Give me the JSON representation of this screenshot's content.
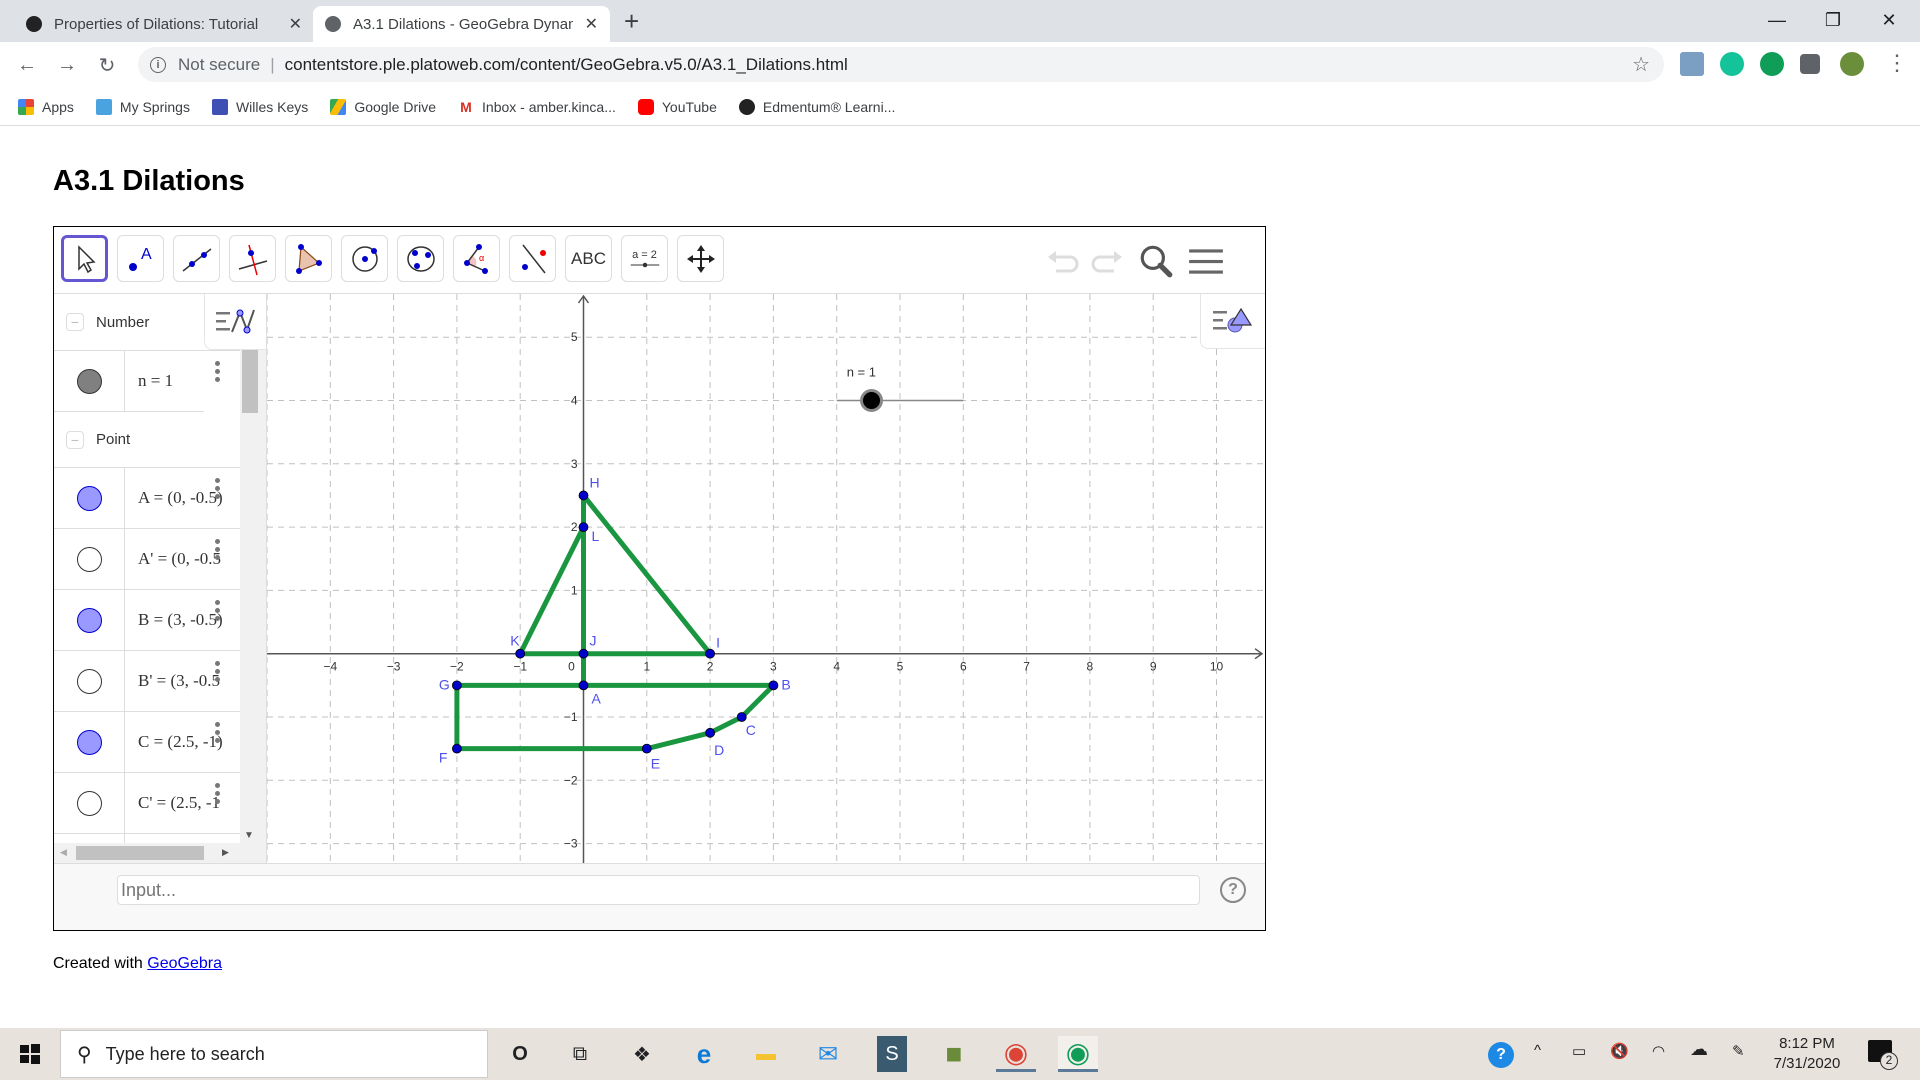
{
  "browser": {
    "tabs": [
      {
        "title": "Properties of Dilations: Tutorial",
        "icon": "edmentum-icon",
        "active": false
      },
      {
        "title": "A3.1 Dilations - GeoGebra Dynam",
        "icon": "globe-icon",
        "active": true
      }
    ],
    "new_tab": "+",
    "close_glyph": "✕",
    "window_controls": {
      "minimize": "—",
      "maximize": "❐",
      "close": "✕"
    },
    "nav": {
      "back": "←",
      "forward": "→",
      "reload": "↻"
    },
    "security_label": "Not secure",
    "url": "contentstore.ple.platoweb.com/content/GeoGebra.v5.0/A3.1_Dilations.html",
    "star": "☆",
    "menu": "⋮",
    "extensions": [
      {
        "name": "anime-extension-icon",
        "color": "#7a9fc2"
      },
      {
        "name": "grammarly-icon",
        "color": "#15c39a"
      },
      {
        "name": "chat-extension-icon",
        "color": "#0f9d58"
      },
      {
        "name": "extensions-puzzle-icon",
        "color": "#5f6368"
      },
      {
        "name": "profile-avatar",
        "color": "#6b8e3a"
      }
    ],
    "bookmarks": [
      {
        "label": "Apps",
        "icon": "apps-grid-icon",
        "color": "#ea4335"
      },
      {
        "label": "My Springs",
        "icon": "graduation-cap-icon",
        "color": "#4aa3df"
      },
      {
        "label": "Willes Keys",
        "icon": "forms-icon",
        "color": "#3f51b5"
      },
      {
        "label": "Google Drive",
        "icon": "google-drive-icon",
        "color": "#fbbc04"
      },
      {
        "label": "Inbox - amber.kinca...",
        "icon": "gmail-icon",
        "color": "#d93025"
      },
      {
        "label": "YouTube",
        "icon": "youtube-icon",
        "color": "#ff0000"
      },
      {
        "label": "Edmentum® Learni...",
        "icon": "edmentum-icon",
        "color": "#222222"
      }
    ]
  },
  "page": {
    "title": "A3.1 Dilations",
    "credit_prefix": "Created with ",
    "credit_link": "GeoGebra"
  },
  "geogebra": {
    "tools": [
      {
        "name": "move-tool",
        "selected": true
      },
      {
        "name": "point-tool"
      },
      {
        "name": "line-tool"
      },
      {
        "name": "perpendicular-line-tool"
      },
      {
        "name": "polygon-tool"
      },
      {
        "name": "circle-center-point-tool"
      },
      {
        "name": "circle-three-points-tool"
      },
      {
        "name": "angle-tool"
      },
      {
        "name": "reflect-line-tool"
      },
      {
        "name": "text-tool",
        "label": "ABC"
      },
      {
        "name": "slider-tool",
        "label": "a = 2"
      },
      {
        "name": "move-graphics-tool"
      }
    ],
    "algebra": {
      "groups": [
        {
          "label": "Number",
          "items": [
            {
              "text": "n = 1",
              "marker": "filled-gray"
            }
          ]
        },
        {
          "label": "Point",
          "items": [
            {
              "text": "A = (0, -0.5)",
              "marker": "filled-blue"
            },
            {
              "text": "A' = (0, -0.5",
              "marker": "hollow"
            },
            {
              "text": "B = (3, -0.5)",
              "marker": "filled-blue"
            },
            {
              "text": "B' = (3, -0.5",
              "marker": "hollow"
            },
            {
              "text": "C = (2.5, -1)",
              "marker": "filled-blue"
            },
            {
              "text": "C' = (2.5, -1",
              "marker": "hollow"
            }
          ]
        }
      ]
    },
    "input_placeholder": "Input...",
    "help": "?",
    "colors": {
      "segment": "#1a9641",
      "point": "#0000cc",
      "label": "#5050ee",
      "grid": "#c0c0c0",
      "axis": "#555555",
      "tool_selected": "#6557d2"
    },
    "graph": {
      "x_ticks": [
        -4,
        -3,
        -2,
        -1,
        0,
        1,
        2,
        3,
        4,
        5,
        6,
        7,
        8,
        9,
        10
      ],
      "y_ticks": [
        -3,
        -2,
        -1,
        1,
        2,
        3,
        4,
        5
      ],
      "points": [
        {
          "label": "A",
          "x": 0,
          "y": -0.5
        },
        {
          "label": "B",
          "x": 3,
          "y": -0.5
        },
        {
          "label": "C",
          "x": 2.5,
          "y": -1
        },
        {
          "label": "D",
          "x": 2,
          "y": -1.25
        },
        {
          "label": "E",
          "x": 1,
          "y": -1.5
        },
        {
          "label": "F",
          "x": -2,
          "y": -1.5
        },
        {
          "label": "G",
          "x": -2,
          "y": -0.5
        },
        {
          "label": "H",
          "x": 0,
          "y": 2.5
        },
        {
          "label": "I",
          "x": 2,
          "y": 0
        },
        {
          "label": "J",
          "x": 0,
          "y": 0
        },
        {
          "label": "K",
          "x": -1,
          "y": 0
        },
        {
          "label": "L",
          "x": 0,
          "y": 2
        }
      ],
      "segments": [
        [
          "G",
          "B"
        ],
        [
          "B",
          "C"
        ],
        [
          "C",
          "D"
        ],
        [
          "D",
          "E"
        ],
        [
          "E",
          "F"
        ],
        [
          "F",
          "G"
        ],
        [
          "K",
          "I"
        ],
        [
          "I",
          "H"
        ],
        [
          "H",
          "A"
        ],
        [
          "K",
          "L"
        ]
      ],
      "slider": {
        "label": "n = 1",
        "x_start": 4,
        "x_end": 6,
        "y": 4,
        "value": 1,
        "handle_x": 4.55
      }
    }
  },
  "taskbar": {
    "search_placeholder": "Type here to search",
    "apps": [
      {
        "name": "cortana-icon",
        "glyph": "O"
      },
      {
        "name": "task-view-icon",
        "glyph": "⧉"
      },
      {
        "name": "dropbox-icon",
        "glyph": "❖"
      },
      {
        "name": "edge-icon",
        "glyph": "e"
      },
      {
        "name": "file-explorer-icon",
        "glyph": "▬"
      },
      {
        "name": "mail-icon",
        "glyph": "✉"
      },
      {
        "name": "app-s-icon",
        "glyph": "S"
      },
      {
        "name": "minecraft-icon",
        "glyph": "■"
      },
      {
        "name": "chrome-profile-m-icon",
        "glyph": "◉"
      },
      {
        "name": "chrome-icon",
        "glyph": "◉"
      }
    ],
    "tray": {
      "help": "?",
      "chevron": "^",
      "battery": "▭",
      "volume_muted": "🔇",
      "wifi": "◠",
      "onedrive": "☁",
      "pen": "✎",
      "time": "8:12 PM",
      "date": "7/31/2020",
      "notifications": "2"
    }
  }
}
